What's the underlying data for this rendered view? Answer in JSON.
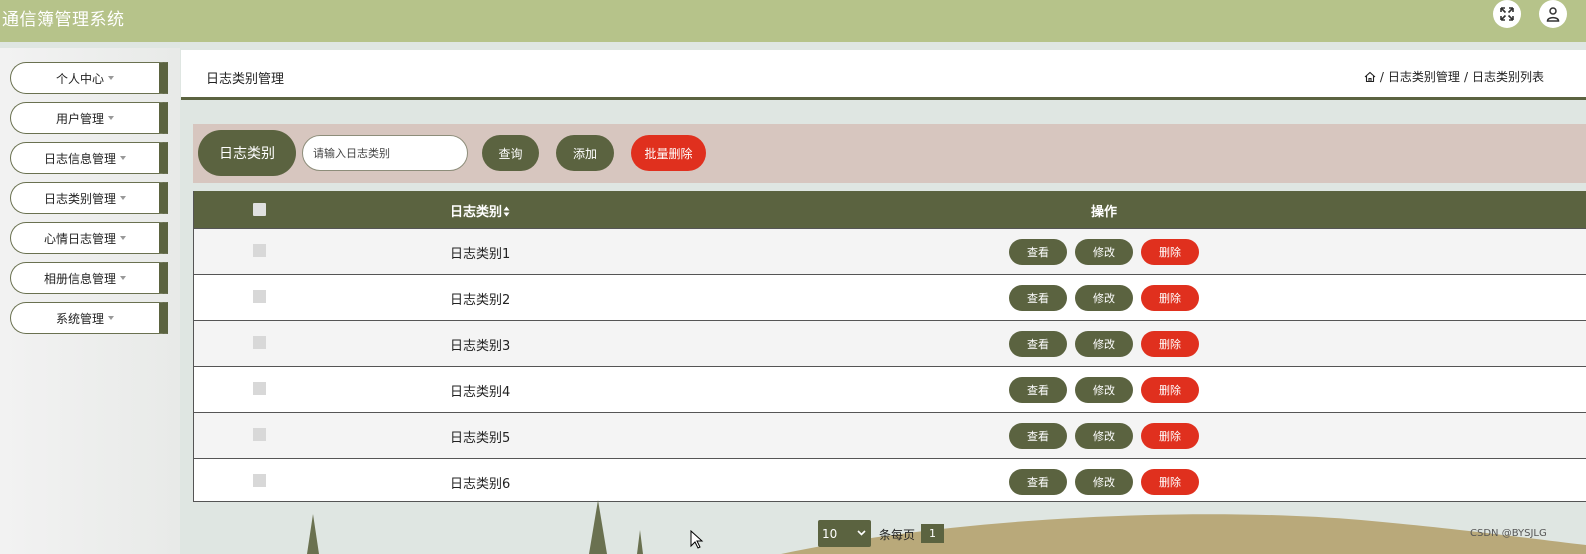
{
  "header": {
    "app_title": "通信簿管理系统",
    "icons": [
      "fullscreen-icon",
      "user-icon"
    ]
  },
  "sidebar": {
    "items": [
      {
        "label": "个人中心"
      },
      {
        "label": "用户管理"
      },
      {
        "label": "日志信息管理"
      },
      {
        "label": "日志类别管理"
      },
      {
        "label": "心情日志管理"
      },
      {
        "label": "相册信息管理"
      },
      {
        "label": "系统管理"
      }
    ]
  },
  "main": {
    "page_title": "日志类别管理",
    "breadcrumb": [
      "日志类别管理",
      "日志类别列表"
    ],
    "breadcrumb_sep": "/"
  },
  "search": {
    "label": "日志类别",
    "placeholder": "请输入日志类别",
    "query_btn": "查询",
    "add_btn": "添加",
    "batch_delete_btn": "批量删除"
  },
  "table": {
    "col_category": "日志类别",
    "col_ops": "操作",
    "rows": [
      {
        "name": "日志类别1"
      },
      {
        "name": "日志类别2"
      },
      {
        "name": "日志类别3"
      },
      {
        "name": "日志类别4"
      },
      {
        "name": "日志类别5"
      },
      {
        "name": "日志类别6"
      }
    ],
    "view_label": "查看",
    "edit_label": "修改",
    "delete_label": "删除"
  },
  "pagination": {
    "page_size": "10",
    "per_page_text": "条每页",
    "current_page": "1"
  },
  "watermark": "CSDN @BYSJLG",
  "colors": {
    "topbar": "#b6c38a",
    "olive": "#5b6340",
    "danger": "#e0301e",
    "search_bg": "#d7c6bf"
  }
}
